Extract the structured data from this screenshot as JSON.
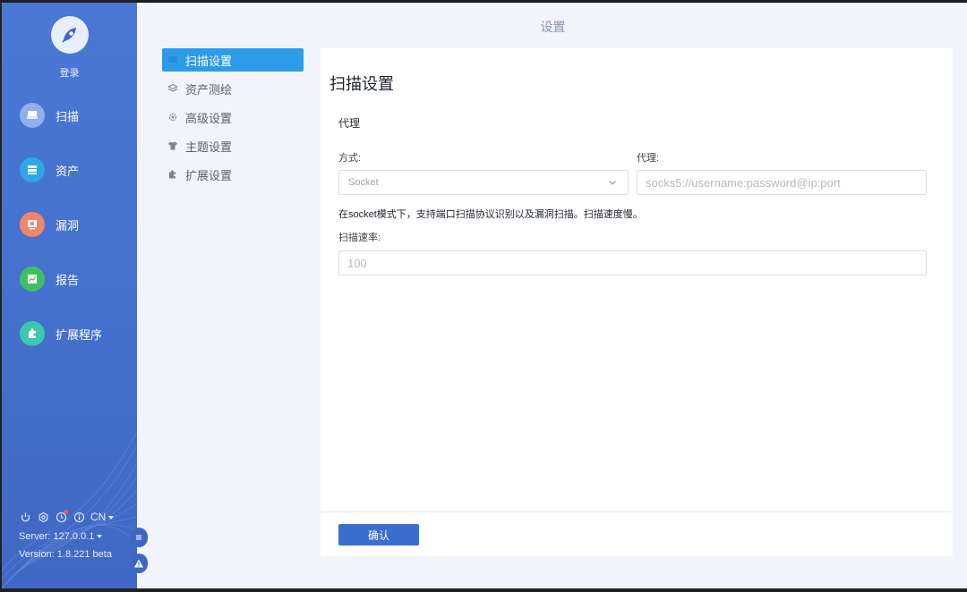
{
  "sidebar": {
    "login": "登录",
    "items": [
      {
        "label": "扫描",
        "icon": "scan-icon",
        "color": "#8fb0ea"
      },
      {
        "label": "资产",
        "icon": "assets-icon",
        "color": "#2fa6e6"
      },
      {
        "label": "漏洞",
        "icon": "vulnerability-icon",
        "color": "#f0876a"
      },
      {
        "label": "报告",
        "icon": "report-icon",
        "color": "#3fbf63"
      },
      {
        "label": "扩展程序",
        "icon": "extension-icon",
        "color": "#3cc7b0"
      }
    ],
    "language": "CN",
    "server": "Server: 127.0.0.1",
    "version": "Version: 1.8.221 beta"
  },
  "header": {
    "title": "设置"
  },
  "menu": {
    "items": [
      {
        "label": "扫描设置",
        "icon": "monitor-icon",
        "active": true
      },
      {
        "label": "资产测绘",
        "icon": "layers-icon",
        "active": false
      },
      {
        "label": "高级设置",
        "icon": "gear-icon",
        "active": false
      },
      {
        "label": "主题设置",
        "icon": "tshirt-icon",
        "active": false
      },
      {
        "label": "扩展设置",
        "icon": "puzzle-icon",
        "active": false
      }
    ]
  },
  "panel": {
    "title": "扫描设置",
    "proxy_section": "代理",
    "mode_label": "方式:",
    "mode_value": "Socket",
    "proxy_label": "代理:",
    "proxy_placeholder": "socks5://username:password@ip:port",
    "hint": "在socket模式下，支持端口扫描协议识别以及漏洞扫描。扫描速度慢。",
    "rate_label": "扫描速率:",
    "rate_placeholder": "100",
    "confirm": "确认"
  },
  "colors": {
    "sidebar": "#4a78d4",
    "accent": "#2d9ce8",
    "button": "#3a6fd0"
  }
}
